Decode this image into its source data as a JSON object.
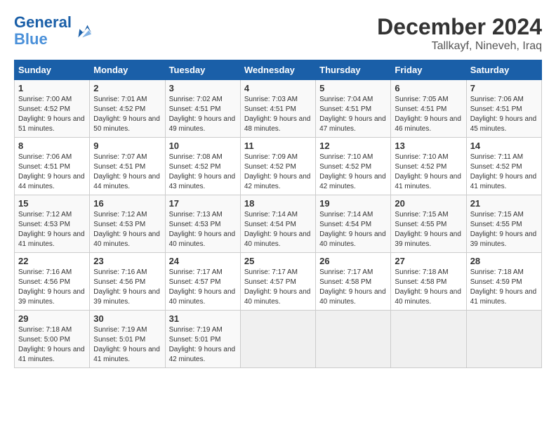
{
  "header": {
    "logo_line1": "General",
    "logo_line2": "Blue",
    "month": "December 2024",
    "location": "Tallkayf, Nineveh, Iraq"
  },
  "days_of_week": [
    "Sunday",
    "Monday",
    "Tuesday",
    "Wednesday",
    "Thursday",
    "Friday",
    "Saturday"
  ],
  "weeks": [
    [
      {
        "day": "1",
        "sunrise": "7:00 AM",
        "sunset": "4:52 PM",
        "daylight": "9 hours and 51 minutes."
      },
      {
        "day": "2",
        "sunrise": "7:01 AM",
        "sunset": "4:52 PM",
        "daylight": "9 hours and 50 minutes."
      },
      {
        "day": "3",
        "sunrise": "7:02 AM",
        "sunset": "4:51 PM",
        "daylight": "9 hours and 49 minutes."
      },
      {
        "day": "4",
        "sunrise": "7:03 AM",
        "sunset": "4:51 PM",
        "daylight": "9 hours and 48 minutes."
      },
      {
        "day": "5",
        "sunrise": "7:04 AM",
        "sunset": "4:51 PM",
        "daylight": "9 hours and 47 minutes."
      },
      {
        "day": "6",
        "sunrise": "7:05 AM",
        "sunset": "4:51 PM",
        "daylight": "9 hours and 46 minutes."
      },
      {
        "day": "7",
        "sunrise": "7:06 AM",
        "sunset": "4:51 PM",
        "daylight": "9 hours and 45 minutes."
      }
    ],
    [
      {
        "day": "8",
        "sunrise": "7:06 AM",
        "sunset": "4:51 PM",
        "daylight": "9 hours and 44 minutes."
      },
      {
        "day": "9",
        "sunrise": "7:07 AM",
        "sunset": "4:51 PM",
        "daylight": "9 hours and 44 minutes."
      },
      {
        "day": "10",
        "sunrise": "7:08 AM",
        "sunset": "4:52 PM",
        "daylight": "9 hours and 43 minutes."
      },
      {
        "day": "11",
        "sunrise": "7:09 AM",
        "sunset": "4:52 PM",
        "daylight": "9 hours and 42 minutes."
      },
      {
        "day": "12",
        "sunrise": "7:10 AM",
        "sunset": "4:52 PM",
        "daylight": "9 hours and 42 minutes."
      },
      {
        "day": "13",
        "sunrise": "7:10 AM",
        "sunset": "4:52 PM",
        "daylight": "9 hours and 41 minutes."
      },
      {
        "day": "14",
        "sunrise": "7:11 AM",
        "sunset": "4:52 PM",
        "daylight": "9 hours and 41 minutes."
      }
    ],
    [
      {
        "day": "15",
        "sunrise": "7:12 AM",
        "sunset": "4:53 PM",
        "daylight": "9 hours and 41 minutes."
      },
      {
        "day": "16",
        "sunrise": "7:12 AM",
        "sunset": "4:53 PM",
        "daylight": "9 hours and 40 minutes."
      },
      {
        "day": "17",
        "sunrise": "7:13 AM",
        "sunset": "4:53 PM",
        "daylight": "9 hours and 40 minutes."
      },
      {
        "day": "18",
        "sunrise": "7:14 AM",
        "sunset": "4:54 PM",
        "daylight": "9 hours and 40 minutes."
      },
      {
        "day": "19",
        "sunrise": "7:14 AM",
        "sunset": "4:54 PM",
        "daylight": "9 hours and 40 minutes."
      },
      {
        "day": "20",
        "sunrise": "7:15 AM",
        "sunset": "4:55 PM",
        "daylight": "9 hours and 39 minutes."
      },
      {
        "day": "21",
        "sunrise": "7:15 AM",
        "sunset": "4:55 PM",
        "daylight": "9 hours and 39 minutes."
      }
    ],
    [
      {
        "day": "22",
        "sunrise": "7:16 AM",
        "sunset": "4:56 PM",
        "daylight": "9 hours and 39 minutes."
      },
      {
        "day": "23",
        "sunrise": "7:16 AM",
        "sunset": "4:56 PM",
        "daylight": "9 hours and 39 minutes."
      },
      {
        "day": "24",
        "sunrise": "7:17 AM",
        "sunset": "4:57 PM",
        "daylight": "9 hours and 40 minutes."
      },
      {
        "day": "25",
        "sunrise": "7:17 AM",
        "sunset": "4:57 PM",
        "daylight": "9 hours and 40 minutes."
      },
      {
        "day": "26",
        "sunrise": "7:17 AM",
        "sunset": "4:58 PM",
        "daylight": "9 hours and 40 minutes."
      },
      {
        "day": "27",
        "sunrise": "7:18 AM",
        "sunset": "4:58 PM",
        "daylight": "9 hours and 40 minutes."
      },
      {
        "day": "28",
        "sunrise": "7:18 AM",
        "sunset": "4:59 PM",
        "daylight": "9 hours and 41 minutes."
      }
    ],
    [
      {
        "day": "29",
        "sunrise": "7:18 AM",
        "sunset": "5:00 PM",
        "daylight": "9 hours and 41 minutes."
      },
      {
        "day": "30",
        "sunrise": "7:19 AM",
        "sunset": "5:01 PM",
        "daylight": "9 hours and 41 minutes."
      },
      {
        "day": "31",
        "sunrise": "7:19 AM",
        "sunset": "5:01 PM",
        "daylight": "9 hours and 42 minutes."
      },
      null,
      null,
      null,
      null
    ]
  ]
}
